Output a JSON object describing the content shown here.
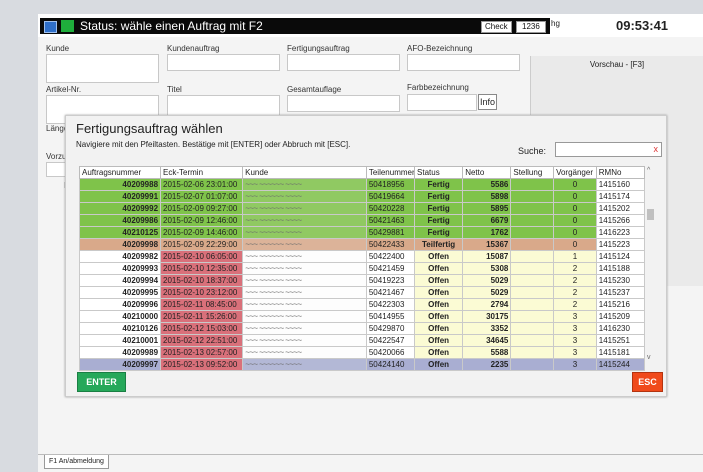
{
  "titlebar": {
    "status": "Status: wähle einen Auftrag mit F2",
    "check_label": "Check",
    "check_value": "1236",
    "hg": "hg",
    "clock": "09:53:41"
  },
  "form": {
    "kunde": "Kunde",
    "kundenauftrag": "Kundenauftrag",
    "fertigungsauftrag": "Fertigungsauftrag",
    "afo": "AFO-Bezeichnung",
    "vorschau": "Vorschau - [F3]",
    "artikel": "Artikel-Nr.",
    "titel": "Titel",
    "gesamtauflage": "Gesamtauflage",
    "farbbezeichnung": "Farbbezeichnung",
    "info": "Info",
    "laenge": "Länge",
    "vorzu": "Vorzu",
    "i_mark": "I"
  },
  "dialog": {
    "title": "Fertigungsauftrag wählen",
    "desc": "Navigiere mit den Pfeiltasten. Bestätige mit [ENTER] oder Abbruch mit [ESC].",
    "search_label": "Suche:",
    "search_value": "",
    "search_clear": "x",
    "scroll_up": "^",
    "scroll_down": "v",
    "enter": "ENTER",
    "esc": "ESC"
  },
  "table": {
    "columns": [
      "Auftragsnummer",
      "Eck-Termin",
      "Kunde",
      "Teilenummer",
      "Status",
      "Netto",
      "Stellung",
      "Vorgänger",
      "RMNo"
    ],
    "rows": [
      {
        "id": "40209988",
        "termin": "2015-02-06 23:01:00",
        "kunde": "~~~ ~~~~~~ ~~~~",
        "teil": "50418956",
        "status": "Fertig",
        "netto": "5586",
        "stellung": "",
        "vg": "0",
        "rm": "1415160",
        "type": "done"
      },
      {
        "id": "40209991",
        "termin": "2015-02-07 01:07:00",
        "kunde": "~~~ ~~~~~~ ~~~~",
        "teil": "50419664",
        "status": "Fertig",
        "netto": "5898",
        "stellung": "",
        "vg": "0",
        "rm": "1415174",
        "type": "done"
      },
      {
        "id": "40209992",
        "termin": "2015-02-09 09:27:00",
        "kunde": "~~~ ~~~~~~ ~~~~",
        "teil": "50420228",
        "status": "Fertig",
        "netto": "5895",
        "stellung": "",
        "vg": "0",
        "rm": "1415202",
        "type": "done"
      },
      {
        "id": "40209986",
        "termin": "2015-02-09 12:46:00",
        "kunde": "~~~ ~~~~~~ ~~~~",
        "teil": "50421463",
        "status": "Fertig",
        "netto": "6679",
        "stellung": "",
        "vg": "0",
        "rm": "1415266",
        "type": "done"
      },
      {
        "id": "40210125",
        "termin": "2015-02-09 14:46:00",
        "kunde": "~~~ ~~~~~~ ~~~~",
        "teil": "50429881",
        "status": "Fertig",
        "netto": "1762",
        "stellung": "",
        "vg": "0",
        "rm": "1416223",
        "type": "done"
      },
      {
        "id": "40209998",
        "termin": "2015-02-09 22:29:00",
        "kunde": "~~~ ~~~~~~ ~~~~",
        "teil": "50422433",
        "status": "Teilfertig",
        "netto": "15367",
        "stellung": "",
        "vg": "0",
        "rm": "1415223",
        "type": "partial"
      },
      {
        "id": "40209982",
        "termin": "2015-02-10 06:05:00",
        "kunde": "~~~ ~~~~~~ ~~~~",
        "teil": "50422400",
        "status": "Offen",
        "netto": "15087",
        "stellung": "",
        "vg": "1",
        "rm": "1415124",
        "type": "open"
      },
      {
        "id": "40209993",
        "termin": "2015-02-10 12:35:00",
        "kunde": "~~~ ~~~~~~ ~~~~",
        "teil": "50421459",
        "status": "Offen",
        "netto": "5308",
        "stellung": "",
        "vg": "2",
        "rm": "1415188",
        "type": "open"
      },
      {
        "id": "40209994",
        "termin": "2015-02-10 18:37:00",
        "kunde": "~~~ ~~~~~~ ~~~~",
        "teil": "50419223",
        "status": "Offen",
        "netto": "5029",
        "stellung": "",
        "vg": "2",
        "rm": "1415230",
        "type": "open"
      },
      {
        "id": "40209995",
        "termin": "2015-02-10 23:12:00",
        "kunde": "~~~ ~~~~~~ ~~~~",
        "teil": "50421467",
        "status": "Offen",
        "netto": "5029",
        "stellung": "",
        "vg": "2",
        "rm": "1415237",
        "type": "open"
      },
      {
        "id": "40209996",
        "termin": "2015-02-11 08:45:00",
        "kunde": "~~~ ~~~~~~ ~~~~",
        "teil": "50422303",
        "status": "Offen",
        "netto": "2794",
        "stellung": "",
        "vg": "2",
        "rm": "1415216",
        "type": "open"
      },
      {
        "id": "40210000",
        "termin": "2015-02-11 15:26:00",
        "kunde": "~~~ ~~~~~~ ~~~~",
        "teil": "50414955",
        "status": "Offen",
        "netto": "30175",
        "stellung": "",
        "vg": "3",
        "rm": "1415209",
        "type": "open"
      },
      {
        "id": "40210126",
        "termin": "2015-02-12 15:03:00",
        "kunde": "~~~ ~~~~~~ ~~~~",
        "teil": "50429870",
        "status": "Offen",
        "netto": "3352",
        "stellung": "",
        "vg": "3",
        "rm": "1416230",
        "type": "open"
      },
      {
        "id": "40210001",
        "termin": "2015-02-12 22:51:00",
        "kunde": "~~~ ~~~~~~ ~~~~",
        "teil": "50422547",
        "status": "Offen",
        "netto": "34645",
        "stellung": "",
        "vg": "3",
        "rm": "1415251",
        "type": "open"
      },
      {
        "id": "40209989",
        "termin": "2015-02-13 02:57:00",
        "kunde": "~~~ ~~~~~~ ~~~~",
        "teil": "50420066",
        "status": "Offen",
        "netto": "5588",
        "stellung": "",
        "vg": "3",
        "rm": "1415181",
        "type": "open"
      },
      {
        "id": "40209997",
        "termin": "2015-02-13 09:52:00",
        "kunde": "~~~ ~~~~~~ ~~~~",
        "teil": "50424140",
        "status": "Offen",
        "netto": "2235",
        "stellung": "",
        "vg": "3",
        "rm": "1415244",
        "type": "selected"
      }
    ]
  },
  "footer": {
    "tab": "F1 An/abmeldung"
  },
  "colors": {
    "done": "#7fc34a",
    "partial": "#d9a98a",
    "open": "#ffffff",
    "selected": "#a9aed2",
    "termin_red": "#d9707a",
    "netto_yellow": "#fbfbd4"
  }
}
